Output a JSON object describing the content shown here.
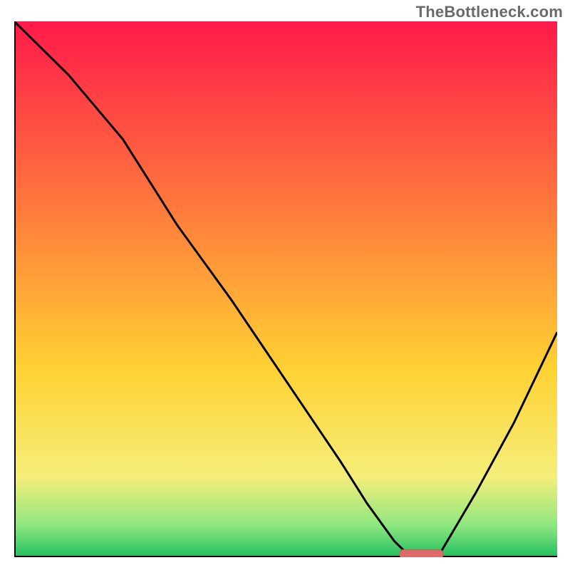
{
  "watermark": "TheBottleneck.com",
  "colors": {
    "gradient_top": "#ff1a4a",
    "gradient_mid_upper": "#ff7a3c",
    "gradient_mid": "#ffd233",
    "gradient_mid_lower": "#f5ee7a",
    "gradient_green_light": "#8fe780",
    "gradient_green": "#21c060",
    "axis": "#000000",
    "curve": "#000000",
    "marker_fill": "#e06a6a",
    "marker_stroke": "#d45a5a"
  },
  "chart_data": {
    "type": "line",
    "title": "",
    "xlabel": "",
    "ylabel": "",
    "xlim": [
      0,
      100
    ],
    "ylim": [
      0,
      100
    ],
    "series": [
      {
        "name": "bottleneck-curve",
        "x": [
          0,
          10,
          20,
          30,
          40,
          50,
          60,
          65,
          70,
          73,
          78,
          85,
          92,
          100
        ],
        "y": [
          100,
          90,
          78,
          62,
          48,
          33,
          18,
          10,
          3,
          0,
          0,
          12,
          25,
          42
        ]
      }
    ],
    "optimum_marker": {
      "x_start": 71,
      "x_end": 79,
      "y": 0.5
    },
    "background": {
      "style": "vertical-gradient",
      "stops": [
        {
          "pos": 0.0,
          "color": "#ff1a4a"
        },
        {
          "pos": 0.35,
          "color": "#ff7a3c"
        },
        {
          "pos": 0.65,
          "color": "#ffd233"
        },
        {
          "pos": 0.85,
          "color": "#f5ee7a"
        },
        {
          "pos": 0.94,
          "color": "#8fe780"
        },
        {
          "pos": 1.0,
          "color": "#21c060"
        }
      ]
    }
  }
}
